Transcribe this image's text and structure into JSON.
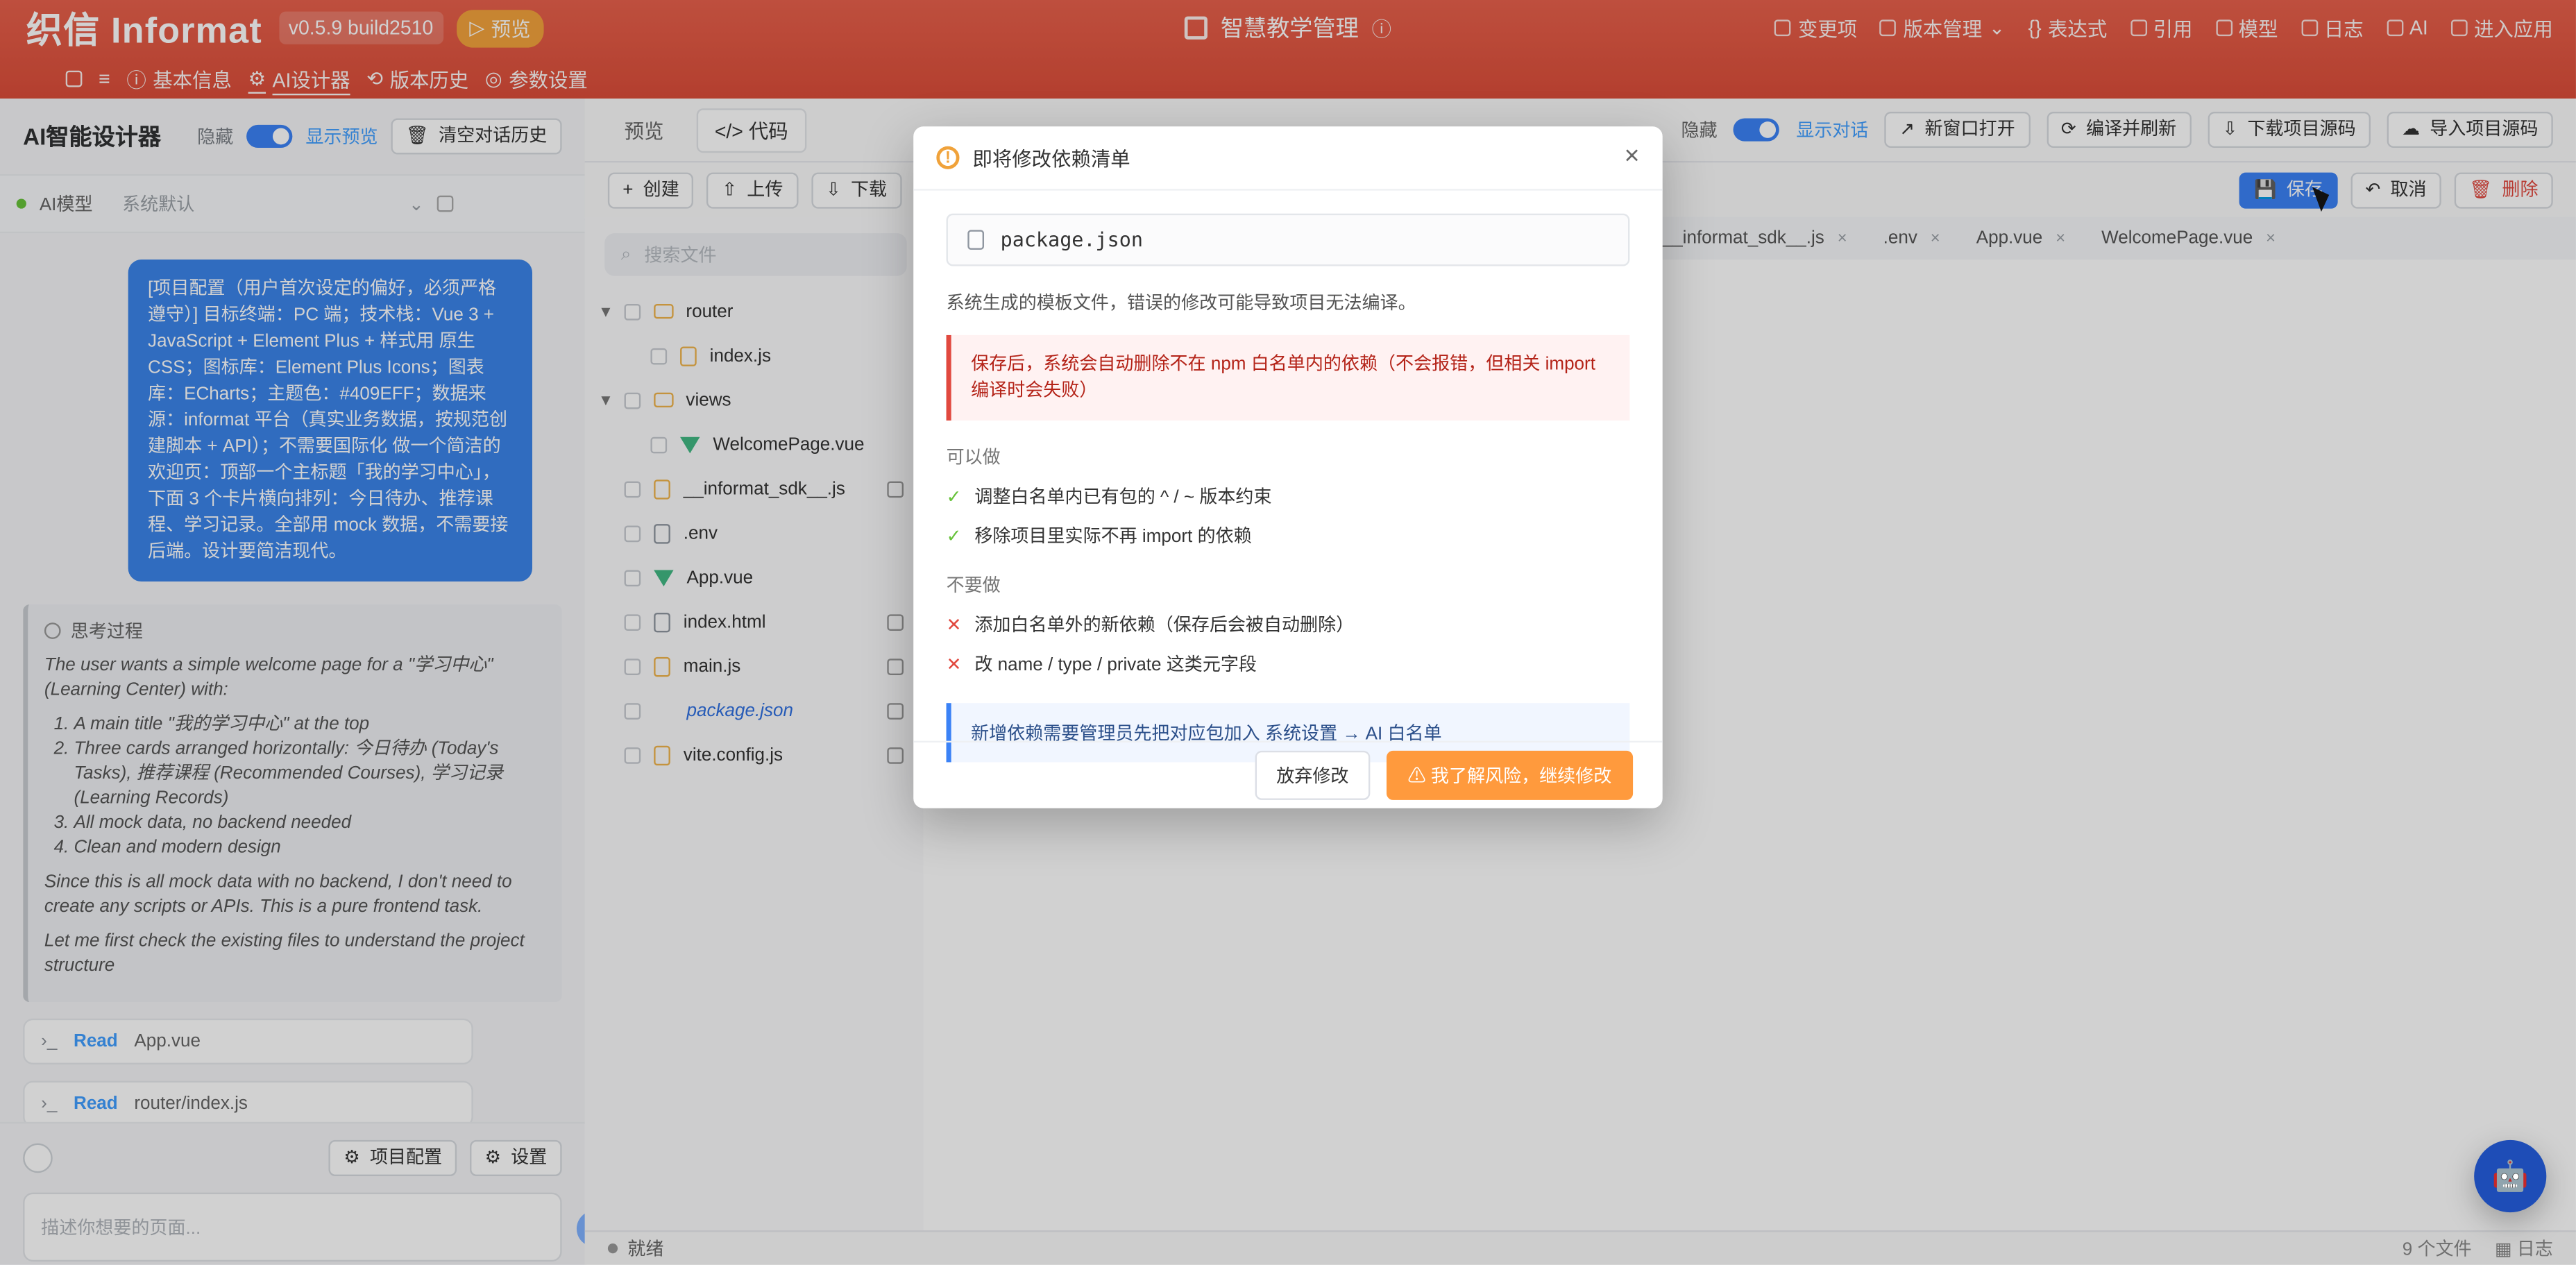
{
  "app": {
    "logo": "织信 Informat",
    "version": "v0.5.9 build2510",
    "preview_badge": "预览",
    "title": "智慧教学管理"
  },
  "top_nav": {
    "items": [
      {
        "label": "变更项"
      },
      {
        "label": "版本管理"
      },
      {
        "label": "表达式"
      },
      {
        "label": "引用"
      },
      {
        "label": "模型"
      },
      {
        "label": "日志"
      },
      {
        "label": "AI"
      },
      {
        "label": "进入应用"
      }
    ],
    "sub_items": [
      {
        "label": "基本信息"
      },
      {
        "label": "AI设计器"
      },
      {
        "label": "版本历史"
      },
      {
        "label": "参数设置"
      }
    ]
  },
  "left_panel": {
    "title": "AI智能设计器",
    "hide_label": "隐藏",
    "show_preview": "显示预览",
    "clear_history": "清空对话历史",
    "ai_model_label": "AI模型",
    "ai_model_value": "系统默认",
    "user_message": "[项目配置（用户首次设定的偏好，必须严格遵守）] 目标终端：PC 端；技术栈：Vue 3 + JavaScript + Element Plus + 样式用 原生 CSS；图标库：Element Plus Icons；图表库：ECharts；主题色：#409EFF；数据来源：informat 平台（真实业务数据，按规范创建脚本 + API）；不需要国际化 做一个简洁的欢迎页：顶部一个主标题「我的学习中心」，下面 3 个卡片横向排列：今日待办、推荐课程、学习记录。全部用 mock 数据，不需要接后端。设计要简洁现代。",
    "thinking_title": "思考过程",
    "thinking_intro": "The user wants a simple welcome page for a \"学习中心\" (Learning Center) with:",
    "thinking_list": [
      "A main title \"我的学习中心\" at the top",
      "Three cards arranged horizontally: 今日待办 (Today's Tasks), 推荐课程 (Recommended Courses), 学习记录 (Learning Records)",
      "All mock data, no backend needed",
      "Clean and modern design"
    ],
    "thinking_p2": "Since this is all mock data with no backend, I don't need to create any scripts or APIs. This is a pure frontend task.",
    "thinking_p3": "Let me first check the existing files to understand the project structure",
    "tools": [
      {
        "kind": "Read",
        "path": "App.vue"
      },
      {
        "kind": "Read",
        "path": "router/index.js"
      }
    ],
    "bottom_actions": {
      "project_config": "项目配置",
      "settings": "设置"
    },
    "input_placeholder": "描述你想要的页面..."
  },
  "right_panel": {
    "tabs": [
      {
        "label": "预览"
      },
      {
        "label": "代码"
      }
    ],
    "hide_label": "隐藏",
    "show_chat": "显示对话",
    "open_new_window": "新窗口打开",
    "compile_refresh": "编译并刷新",
    "download_source": "下载项目源码",
    "import_source": "导入项目源码",
    "toolbar": {
      "create": "创建",
      "upload": "上传",
      "download": "下载",
      "save": "保存",
      "cancel": "取消",
      "delete": "删除"
    },
    "search_placeholder": "搜索文件",
    "tree": [
      {
        "name": "router",
        "type": "folder",
        "expanded": true
      },
      {
        "name": "index.js",
        "type": "js",
        "indent": 1
      },
      {
        "name": "views",
        "type": "folder",
        "expanded": true
      },
      {
        "name": "WelcomePage.vue",
        "type": "vue",
        "indent": 1
      },
      {
        "name": "__informat_sdk__.js",
        "type": "js",
        "locked": true
      },
      {
        "name": ".env",
        "type": "file"
      },
      {
        "name": "App.vue",
        "type": "vue"
      },
      {
        "name": "index.html",
        "type": "file",
        "locked": true
      },
      {
        "name": "main.js",
        "type": "js",
        "locked": true
      },
      {
        "name": "package.json",
        "type": "json",
        "locked": true,
        "selected": true
      },
      {
        "name": "vite.config.js",
        "type": "js",
        "locked": true
      }
    ],
    "open_tabs": [
      {
        "label": "__informat_sdk__.js"
      },
      {
        "label": ".env"
      },
      {
        "label": "App.vue"
      },
      {
        "label": "WelcomePage.vue"
      }
    ],
    "status": {
      "left": "就绪",
      "files": "9 个文件",
      "log": "日志"
    }
  },
  "dialog": {
    "title": "即将修改依赖清单",
    "file": "package.json",
    "desc": "系统生成的模板文件，错误的修改可能导致项目无法编译。",
    "danger": "保存后，系统会自动删除不在 npm 白名单内的依赖（不会报错，但相关 import 编译时会失败）",
    "can_title": "可以做",
    "can_items": [
      "调整白名单内已有包的 ^ / ~ 版本约束",
      "移除项目里实际不再 import 的依赖"
    ],
    "cannot_title": "不要做",
    "cannot_items": [
      "添加白名单外的新依赖（保存后会被自动删除）",
      "改 name / type / private 这类元字段"
    ],
    "info": "新增依赖需要管理员先把对应包加入 系统设置 → AI 白名单",
    "buttons": {
      "discard": "放弃修改",
      "continue": "⚠ 我了解风险，继续修改"
    }
  }
}
